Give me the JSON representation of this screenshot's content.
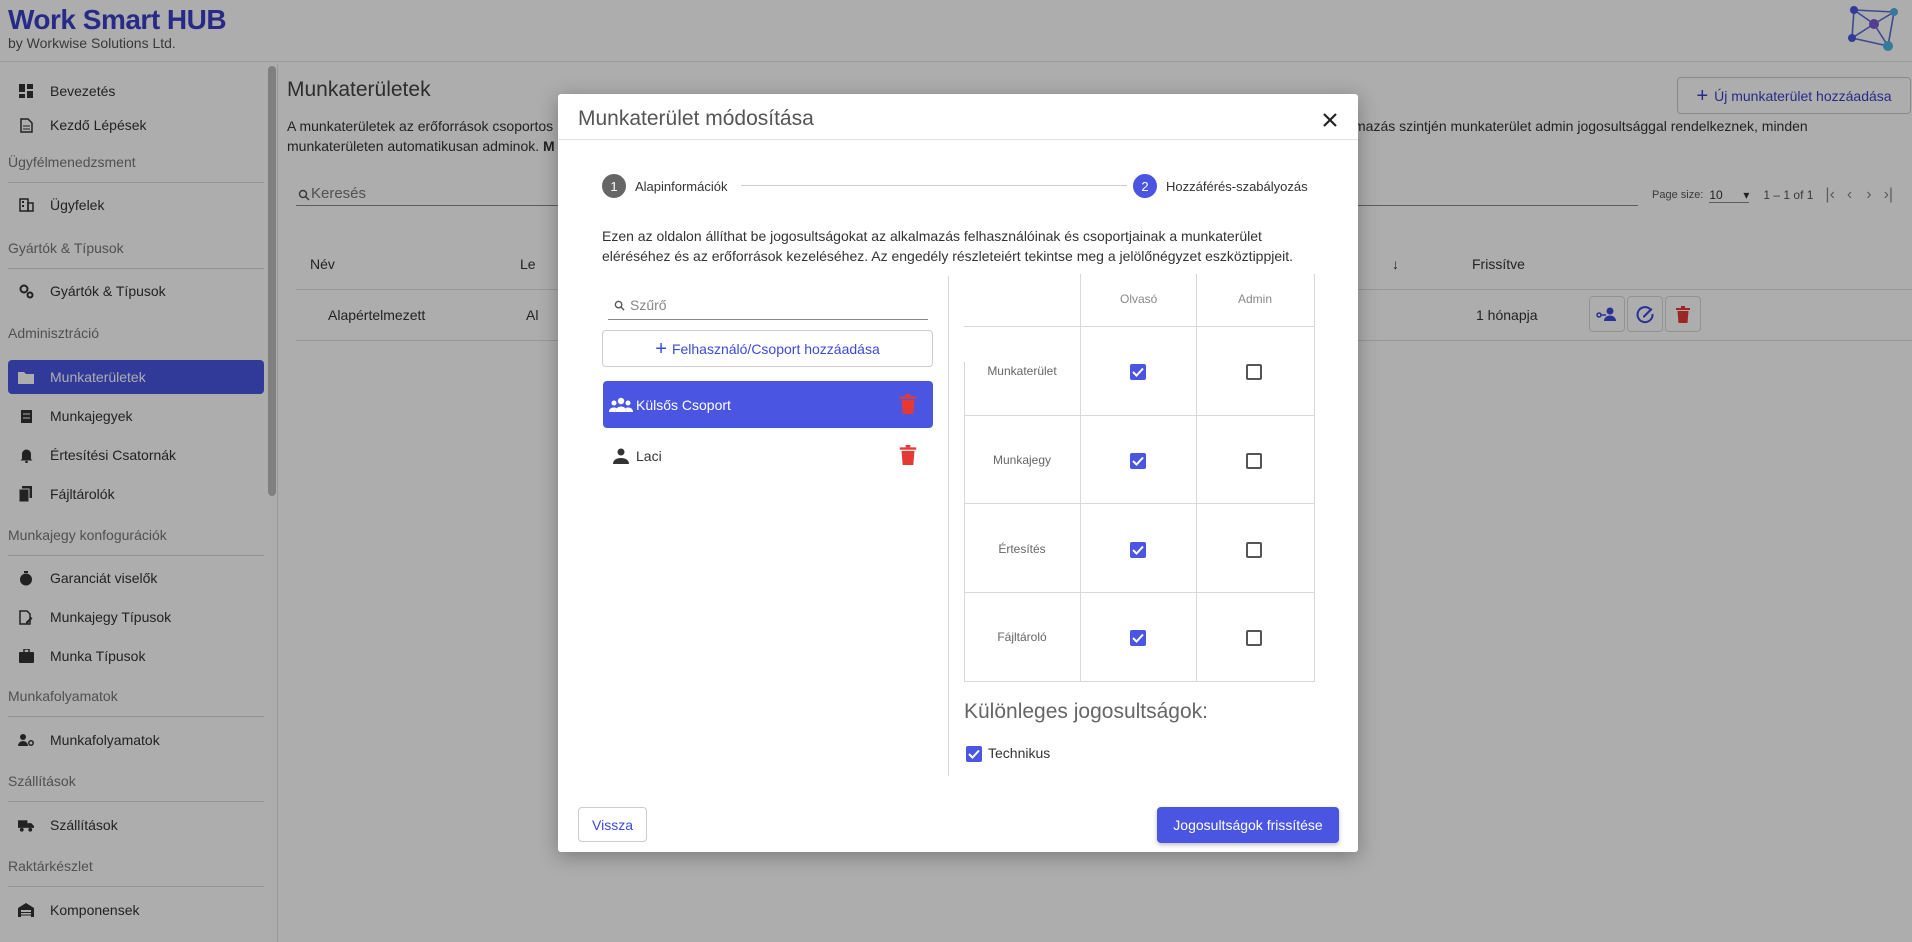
{
  "header": {
    "title": "Work Smart HUB",
    "subtitle": "by Workwise Solutions Ltd.",
    "logo_icon": "network-logo-icon"
  },
  "sidebar": {
    "items": [
      {
        "label": "Bevezetés",
        "icon": "dashboard-icon"
      },
      {
        "label": "Kezdő Lépések",
        "icon": "document-icon"
      },
      {
        "section": "Ügyfélmenedzsment"
      },
      {
        "label": "Ügyfelek",
        "icon": "building-icon"
      },
      {
        "section": "Gyártók & Típusok"
      },
      {
        "label": "Gyártók & Típusok",
        "icon": "gears-icon"
      },
      {
        "section": "Adminisztráció"
      },
      {
        "label": "Munkaterületek",
        "icon": "folder-icon",
        "active": true
      },
      {
        "label": "Munkajegyek",
        "icon": "ticket-icon"
      },
      {
        "label": "Értesítési Csatornák",
        "icon": "bell-icon"
      },
      {
        "label": "Fájltárolók",
        "icon": "files-icon"
      },
      {
        "section": "Munkajegy konfogurációk"
      },
      {
        "label": "Garanciát viselők",
        "icon": "stopwatch-icon"
      },
      {
        "label": "Munkajegy Típusok",
        "icon": "edit-doc-icon"
      },
      {
        "label": "Munka Típusok",
        "icon": "briefcase-icon"
      },
      {
        "section": "Munkafolyamatok"
      },
      {
        "label": "Munkafolyamatok",
        "icon": "person-gear-icon"
      },
      {
        "section": "Szállítások"
      },
      {
        "label": "Szállítások",
        "icon": "truck-icon"
      },
      {
        "section": "Raktárkészlet"
      },
      {
        "label": "Komponensek",
        "icon": "warehouse-icon"
      }
    ]
  },
  "main": {
    "title": "Munkaterületek",
    "new_button": "Új munkaterület hozzáadása",
    "description_left_1": "A munkaterületek az erőforrások csoportos",
    "description_right_1": "lkalmazás szintjén munkaterület admin jogosultsággal rendelkeznek, minden",
    "description_left_2": "munkaterületen automatikusan adminok.",
    "description_left_2_bold": "M",
    "search_placeholder": "Keresés",
    "pager": {
      "page_size_label": "Page size:",
      "page_size": "10",
      "range": "1 – 1 of 1"
    },
    "table": {
      "headers": [
        "Név",
        "Le",
        "Frissítve"
      ],
      "rows": [
        {
          "name": "Alapértelmezett",
          "desc": "Al",
          "updated": "1 hónapja"
        }
      ]
    }
  },
  "modal": {
    "title": "Munkaterület módosítása",
    "steps": [
      {
        "num": "1",
        "label": "Alapinformációk"
      },
      {
        "num": "2",
        "label": "Hozzáférés-szabályozás"
      }
    ],
    "intro_line1": "Ezen az oldalon állíthat be jogosultságokat az alkalmazás felhasználóinak és csoportjainak a munkaterület",
    "intro_line2": "eléréséhez és az erőforrások kezeléséhez. Az engedély részleteiért tekintse meg a jelölőnégyzet eszköztippjeit.",
    "filter_placeholder": "Szűrő",
    "add_button": "Felhasználó/Csoport hozzáadása",
    "principals": [
      {
        "name": "Külsős Csoport",
        "type": "group",
        "selected": true
      },
      {
        "name": "Laci",
        "type": "user",
        "selected": false
      }
    ],
    "permission_columns": [
      "Olvasó",
      "Admin"
    ],
    "permission_rows": [
      {
        "label": "Munkaterület",
        "reader": true,
        "admin": false
      },
      {
        "label": "Munkajegy",
        "reader": true,
        "admin": false
      },
      {
        "label": "Értesítés",
        "reader": true,
        "admin": false
      },
      {
        "label": "Fájltároló",
        "reader": true,
        "admin": false
      }
    ],
    "special_title": "Különleges jogosultságok:",
    "special": [
      {
        "label": "Technikus",
        "checked": true
      }
    ],
    "back_button": "Vissza",
    "update_button": "Jogosultságok frissítése",
    "accent_color": "#4a56e2",
    "delete_color": "#e53935"
  }
}
